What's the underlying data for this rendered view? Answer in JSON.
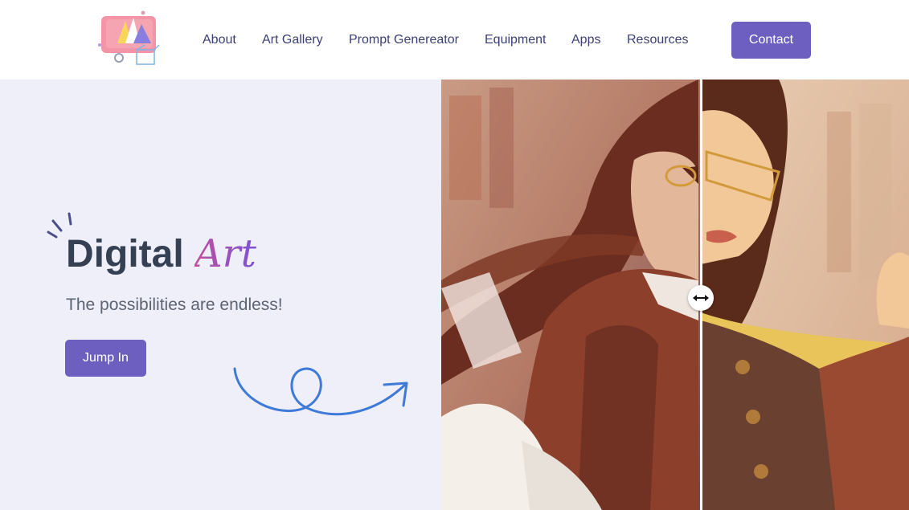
{
  "header": {
    "logo_icon": "art-palette-logo-icon",
    "nav": [
      {
        "label": "About"
      },
      {
        "label": "Art Gallery"
      },
      {
        "label": "Prompt Genereator"
      },
      {
        "label": "Equipment"
      },
      {
        "label": "Apps"
      },
      {
        "label": "Resources"
      }
    ],
    "contact_label": "Contact"
  },
  "hero": {
    "title_main": "Digital",
    "title_accent": "Art",
    "subtitle": "The possibilities are endless!",
    "cta_label": "Jump In",
    "comparison": {
      "handle_icon": "left-right-arrows-icon"
    }
  },
  "colors": {
    "accent": "#6c5fbf",
    "title": "#354052",
    "nav_text": "#3b3f78",
    "hero_bg": "#eeeff8",
    "squiggle": "#3f7ad8"
  }
}
